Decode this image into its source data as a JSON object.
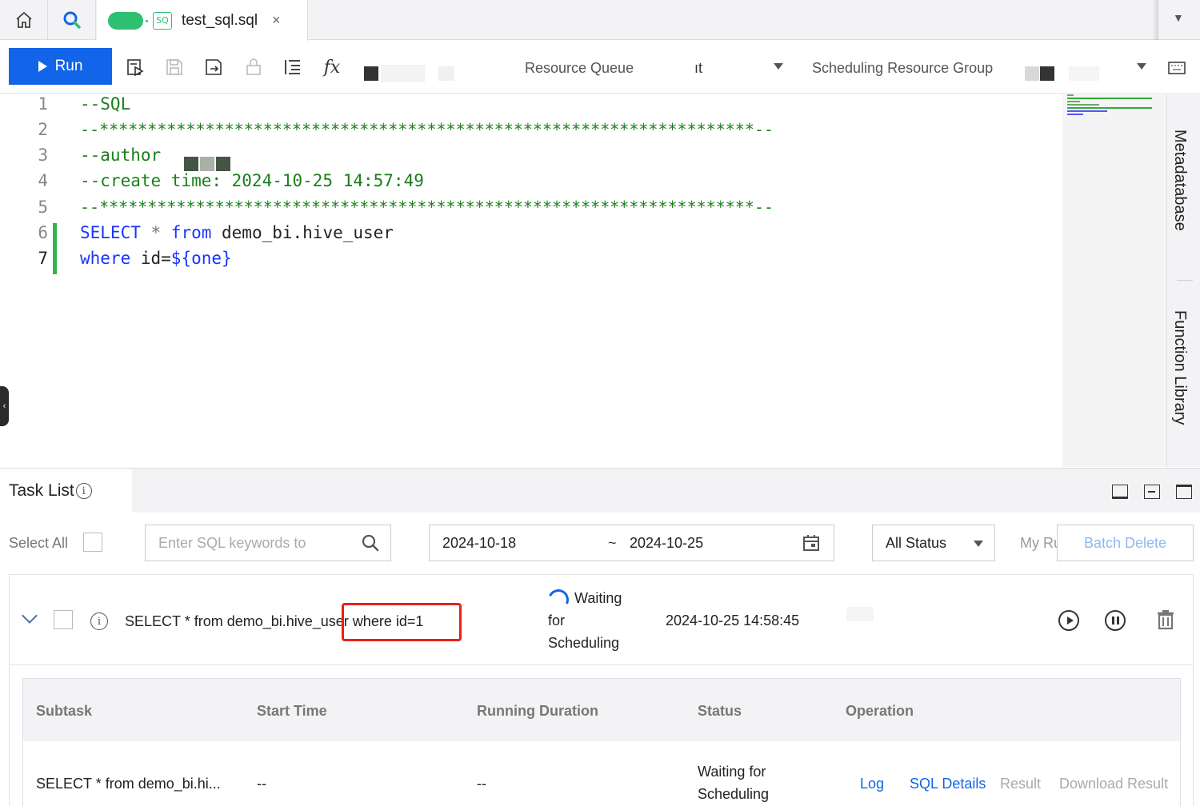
{
  "tabs": {
    "home_icon": "home-icon",
    "search_icon": "search-icon",
    "active_tab": {
      "badge": "SQ",
      "title": "test_sql.sql",
      "close": "×"
    }
  },
  "toolbar": {
    "run_label": "Run",
    "resource_queue_label": "Resource Queue",
    "resource_queue_value": "ıt",
    "scheduling_group_label": "Scheduling Resource Group",
    "fx_label": "fx"
  },
  "editor": {
    "lines": [
      {
        "num": "1",
        "text": "--SQL"
      },
      {
        "num": "2",
        "text": "--********************************************************************--"
      },
      {
        "num": "3",
        "text": "--author"
      },
      {
        "num": "4",
        "text": "--create time: 2024-10-25 14:57:49"
      },
      {
        "num": "5",
        "text": "--********************************************************************--"
      },
      {
        "num": "6",
        "kw1": "SELECT",
        "op": " * ",
        "kw2": "from",
        "rest": " demo_bi.hive_user"
      },
      {
        "num": "7",
        "kw1": "where",
        "rest": " id=",
        "var": "${one}"
      }
    ]
  },
  "side_panel": {
    "metadatabase": "Metadatabase",
    "function_library": "Function Library"
  },
  "task_list": {
    "title": "Task List",
    "filters": {
      "select_all": "Select All",
      "search_placeholder": "Enter SQL keywords to",
      "date_from": "2024-10-18",
      "date_sep": "~",
      "date_to": "2024-10-25",
      "status": "All Status",
      "my_runs": "My Ru",
      "batch_delete": "Batch Delete"
    },
    "task": {
      "sql_prefix": "SELECT * from demo_bi.hive_us",
      "sql_suffix": "er where id=1",
      "status_line1": "Waiting",
      "status_line2": "for",
      "status_line3": "Scheduling",
      "time": "2024-10-25 14:58:45"
    },
    "subtable": {
      "headers": [
        "Subtask",
        "Start Time",
        "Running Duration",
        "Status",
        "Operation"
      ],
      "row": {
        "subtask": "SELECT * from demo_bi.hi...",
        "start_time": "--",
        "duration": "--",
        "status_line1": "Waiting for",
        "status_line2": "Scheduling",
        "ops": [
          "Log",
          "SQL Details",
          "Result",
          "Download Result"
        ]
      }
    }
  }
}
